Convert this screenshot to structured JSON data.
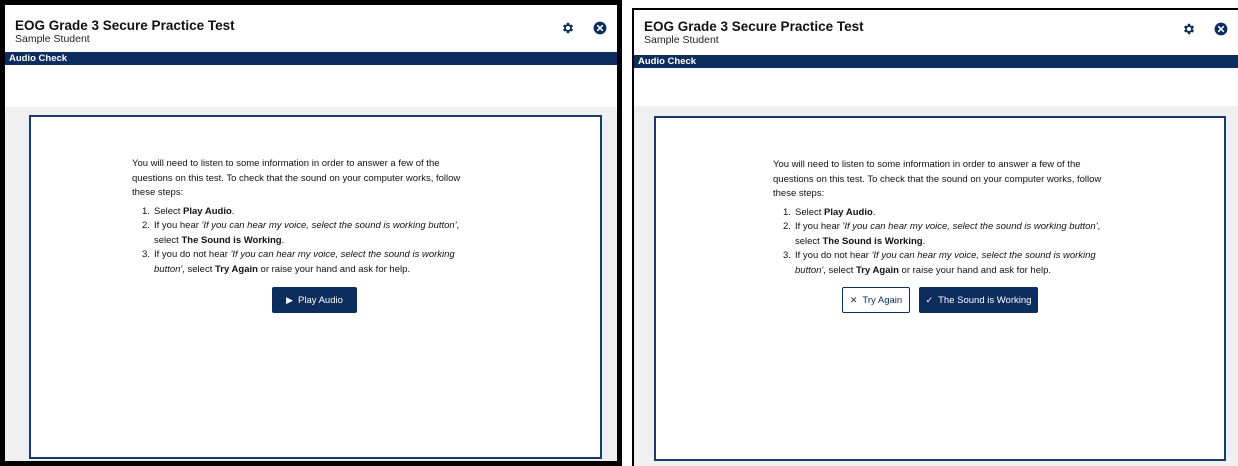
{
  "header": {
    "title": "EOG Grade 3 Secure Practice Test",
    "student": "Sample Student",
    "icons": {
      "settings": "gear-icon",
      "close": "close-circle-icon"
    }
  },
  "section": {
    "label": "Audio Check"
  },
  "instructions": {
    "intro": "You will need to listen to some information in order to answer a few of the questions on this test. To check that the sound on your computer works, follow these steps:",
    "step1": {
      "prefix": "Select ",
      "bold": "Play Audio",
      "suffix": "."
    },
    "step2": {
      "prefix": "If you hear ",
      "italic": "'If you can hear my voice, select the sound is working button'",
      "middle": ", select ",
      "bold": "The Sound is Working",
      "suffix": "."
    },
    "step3": {
      "prefix": "If you do not hear ",
      "italic": "'If you can hear my voice, select the sound is working button'",
      "middle": ", select ",
      "bold": "Try Again",
      "suffix": " or raise your hand and ask for help."
    }
  },
  "buttons": {
    "play_audio": "Play Audio",
    "try_again": "Try Again",
    "sound_working": "The Sound is Working"
  },
  "colors": {
    "brand_navy": "#0d2d5e",
    "border_navy": "#1a3a6e",
    "body_gray": "#f0f0f0"
  }
}
